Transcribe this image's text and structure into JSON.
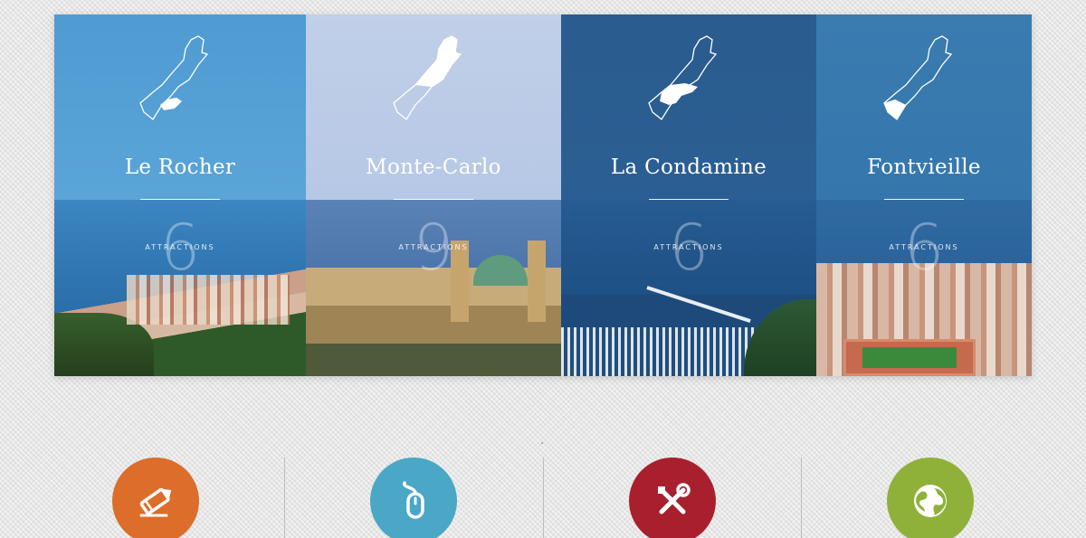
{
  "districts": [
    {
      "name": "Le Rocher",
      "count": "6",
      "count_label": "ATTRACTIONS",
      "highlight_region": "south-rock",
      "color": "#4f9bd2"
    },
    {
      "name": "Monte-Carlo",
      "count": "9",
      "count_label": "ATTRACTIONS",
      "highlight_region": "north-east",
      "color": "#c1cfe8"
    },
    {
      "name": "La Condamine",
      "count": "6",
      "count_label": "ATTRACTIONS",
      "highlight_region": "harbour",
      "color": "#2a5c8f"
    },
    {
      "name": "Fontvieille",
      "count": "6",
      "count_label": "ATTRACTIONS",
      "highlight_region": "south-west",
      "color": "#3a7bb0"
    }
  ],
  "features": [
    {
      "icon": "pencil-icon",
      "color": "#dd6d2a"
    },
    {
      "icon": "mouse-icon",
      "color": "#4aa7c6"
    },
    {
      "icon": "tools-icon",
      "color": "#a8202d"
    },
    {
      "icon": "globe-icon",
      "color": "#8fb13a"
    }
  ]
}
